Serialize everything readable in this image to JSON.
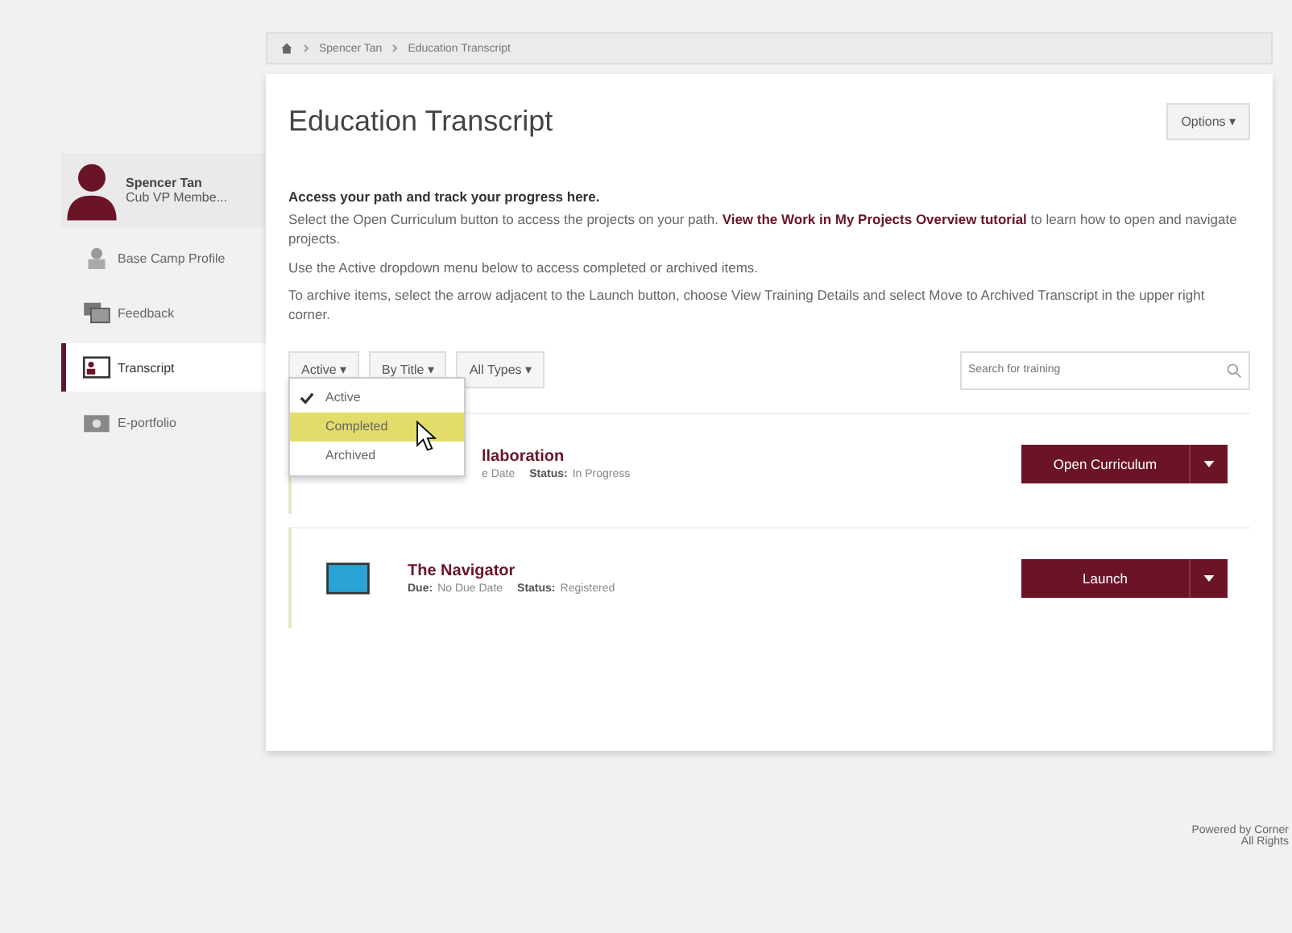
{
  "breadcrumb": [
    "Spencer Tan",
    "Education Transcript"
  ],
  "profile": {
    "name": "Spencer Tan",
    "role": "Cub VP Membe..."
  },
  "sidebar": {
    "items": [
      {
        "label": "Base Camp Profile",
        "kind": "profile",
        "selected": false
      },
      {
        "label": "Feedback",
        "kind": "feedback",
        "selected": false
      },
      {
        "label": "Transcript",
        "kind": "transcript",
        "selected": true
      },
      {
        "label": "E-portfolio",
        "kind": "portfolio",
        "selected": false
      }
    ]
  },
  "page": {
    "title": "Education Transcript",
    "options": "Options ▾"
  },
  "intro": {
    "heading": "Access your path and track your progress here.",
    "paragraphs": [
      "Select the Open Curriculum button to access the projects on your path. **View the Work in My Projects Overview tutorial** to learn how to open and navigate projects.",
      "Use the Active dropdown menu below to access completed or archived items.",
      "To archive items, select the arrow adjacent to the Launch button, choose View Training Details and select Move to Archived Transcript in the upper right corner."
    ]
  },
  "filters": [
    {
      "label": "Active ▾"
    },
    {
      "label": "By Title ▾"
    },
    {
      "label": "All Types ▾"
    }
  ],
  "search": {
    "placeholder": "Search for training"
  },
  "status_menu": [
    {
      "label": "Active",
      "checked": true,
      "hovered": false
    },
    {
      "label": "Completed",
      "checked": false,
      "hovered": true
    },
    {
      "label": "Archived",
      "checked": false,
      "hovered": false
    }
  ],
  "items": [
    {
      "title": "llaboration",
      "due": "e Date",
      "status_label": "Status:",
      "status": "In Progress",
      "button": "Open Curriculum",
      "thumbnail": false
    },
    {
      "title": "The Navigator",
      "due_label": "Due:",
      "due": "No Due Date",
      "status_label": "Status:",
      "status": "Registered",
      "button": "Launch",
      "thumbnail": true
    }
  ],
  "footer": [
    "Powered by Corner",
    "All Rights"
  ]
}
